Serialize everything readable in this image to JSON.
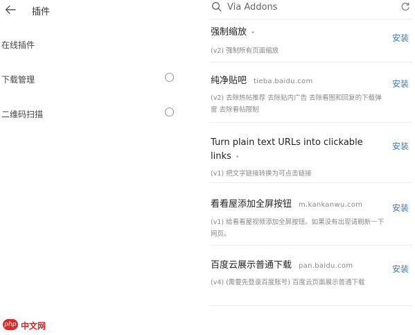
{
  "left": {
    "title": "插件",
    "items": [
      {
        "label": "在线插件",
        "radio": false
      },
      {
        "label": "下载管理",
        "radio": true
      },
      {
        "label": "二维码扫描",
        "radio": true
      }
    ]
  },
  "right": {
    "search_text": "Via Addons",
    "install_label": "安装",
    "addons": [
      {
        "title": "强制缩放",
        "domain": "",
        "dot": "•",
        "desc": "(v2) 强制所有页面缩放"
      },
      {
        "title": "纯净贴吧",
        "domain": "tieba.baidu.com",
        "dot": "",
        "desc": "(v2) 去除热帖推荐 去除贴内广告 去除看图和回复的下载弹窗 去除看帖限制"
      },
      {
        "title": "Turn plain text URLs into clickable links",
        "domain": "",
        "dot": "•",
        "desc": "(v1) 把文字链接转换为可点击链接"
      },
      {
        "title": "看看屋添加全屏按钮",
        "domain": "m.kankanwu.com",
        "dot": "",
        "desc": "(v1) 给看看屋视频添加全屏按钮。如果没有出现请刷新一下网页。"
      },
      {
        "title": "百度云展示普通下载",
        "domain": "pan.baidu.com",
        "dot": "",
        "desc": "(v4) (需要先登录百度账号) 百度云页面展示普通下载"
      }
    ]
  },
  "watermark": {
    "badge": "php",
    "text": "中文网"
  }
}
